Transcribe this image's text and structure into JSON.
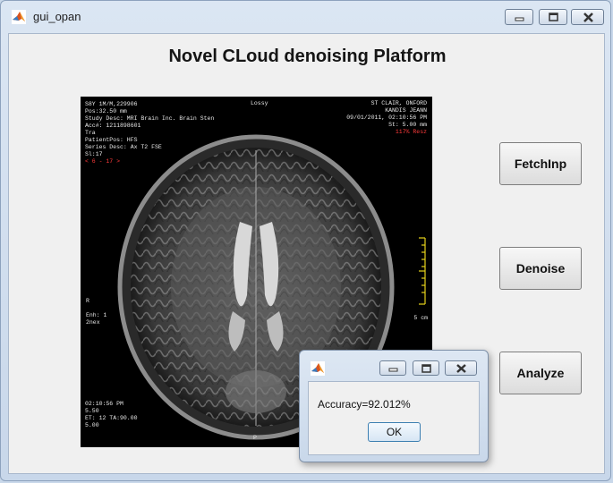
{
  "window": {
    "title": "gui_opan",
    "icon": "matlab-icon",
    "controls": [
      "minimize-icon",
      "maximize-icon",
      "close-icon"
    ]
  },
  "main": {
    "heading": "Novel CLoud denoising Platform",
    "buttons": {
      "fetch": "FetchInp",
      "denoise": "Denoise",
      "analyze": "Analyze"
    }
  },
  "image": {
    "top_left": [
      "S8Y 1M/M,229906",
      "Pos:32.50 mm",
      "Study Desc: MRI Brain Inc. Brain Sten",
      "Acc#: 1211898601",
      "Tra",
      "PatientPos: HFS",
      "Series Desc: Ax T2 FSE",
      "Sl:17"
    ],
    "top_left_red": "< 6 - 17 >",
    "top_center": "Lossy",
    "top_right": [
      "ST CLAIR, ONFORD",
      "KANDIS JEANN",
      "09/01/2011, 02:10:56 PM",
      "St: 5.00 mm"
    ],
    "top_right_red": "117% Resz",
    "left_middle": [
      "R",
      "",
      "Enh: 1",
      "2nex"
    ],
    "bottom_left": [
      "02:10:56 PM",
      "5.50",
      "ET: 12 TA:90.00",
      "5.00"
    ],
    "bottom_center": "P",
    "scale_label": "5 cm",
    "accent": "#e6d21a"
  },
  "dialog": {
    "icon": "matlab-icon",
    "message": "Accuracy=92.012%",
    "ok_label": "OK"
  }
}
